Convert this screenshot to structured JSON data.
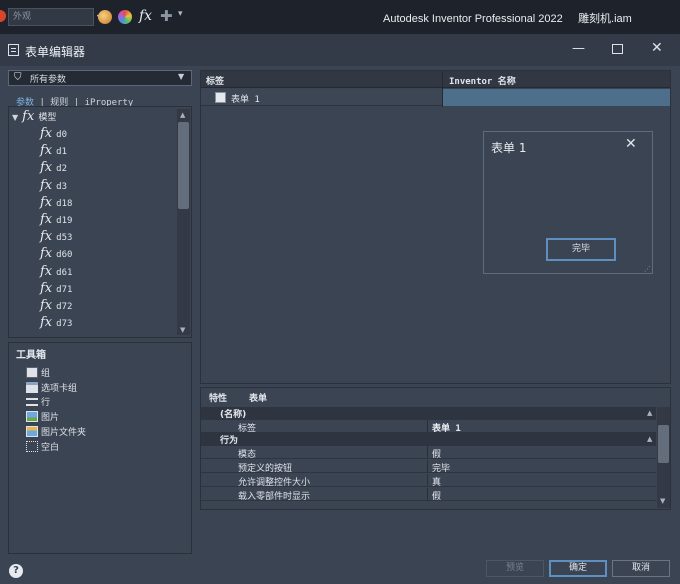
{
  "app": {
    "appearance_placeholder": "外观",
    "title": "Autodesk Inventor Professional 2022",
    "document": "雕刻机.iam"
  },
  "dialog": {
    "title": "表单编辑器"
  },
  "left": {
    "filter_label": "所有参数",
    "tabs": [
      "参数",
      "规则",
      "iProperty"
    ],
    "tree_root": "模型",
    "params": [
      "d0",
      "d1",
      "d2",
      "d3",
      "d18",
      "d19",
      "d53",
      "d60",
      "d61",
      "d71",
      "d72",
      "d73"
    ]
  },
  "toolbox": {
    "title": "工具箱",
    "items": [
      "组",
      "选项卡组",
      "行",
      "图片",
      "图片文件夹",
      "空白"
    ]
  },
  "grid": {
    "col_tag": "标签",
    "col_name": "Inventor 名称",
    "row_label": "表单 1"
  },
  "preview": {
    "title": "表单 1",
    "ok_label": "完毕"
  },
  "properties": {
    "header_key": "特性",
    "header_val": "表单",
    "section_name": "(名称)",
    "tag_key": "标签",
    "tag_val": "表单 1",
    "section_behavior": "行为",
    "rows": [
      {
        "k": "模态",
        "v": "假"
      },
      {
        "k": "预定义的按钮",
        "v": "完毕"
      },
      {
        "k": "允许调整控件大小",
        "v": "真"
      },
      {
        "k": "载入零部件时显示",
        "v": "假"
      }
    ]
  },
  "footer": {
    "preview": "预览",
    "ok": "确定",
    "cancel": "取消"
  }
}
